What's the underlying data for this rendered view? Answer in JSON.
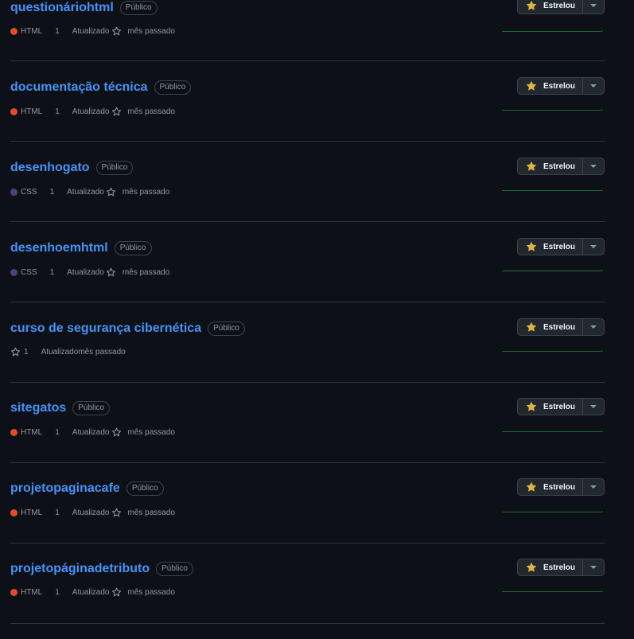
{
  "colors": {
    "html": "#e34c26",
    "css": "#563d7c",
    "star": "#e3b341",
    "spark": "#196c2e"
  },
  "repos": [
    {
      "name": "questionáriohtml",
      "visibility": "Público",
      "language": "HTML",
      "count": "1",
      "updated_label": "Atualizado",
      "updated_time": "mês passado",
      "star_label": "Estrelou"
    },
    {
      "name": "documentação técnica",
      "visibility": "Público",
      "language": "HTML",
      "count": "1",
      "updated_label": "Atualizado",
      "updated_time": "mês passado",
      "star_label": "Estrelou"
    },
    {
      "name": "desenhogato",
      "visibility": "Público",
      "language": "CSS",
      "count": "1",
      "updated_label": "Atualizado",
      "updated_time": "mês passado",
      "star_label": "Estrelou"
    },
    {
      "name": "desenhoemhtml",
      "visibility": "Público",
      "language": "CSS",
      "count": "1",
      "updated_label": "Atualizado",
      "updated_time": "mês passado",
      "star_label": "Estrelou"
    },
    {
      "name": "curso de segurança cibernética",
      "visibility": "Público",
      "language": "",
      "count": "1",
      "updated_label": "Atualizado",
      "updated_time": "mês passado",
      "star_label": "Estrelou"
    },
    {
      "name": "sitegatos",
      "visibility": "Público",
      "language": "HTML",
      "count": "1",
      "updated_label": "Atualizado",
      "updated_time": "mês passado",
      "star_label": "Estrelou"
    },
    {
      "name": "projetopaginacafe",
      "visibility": "Público",
      "language": "HTML",
      "count": "1",
      "updated_label": "Atualizado",
      "updated_time": "mês passado",
      "star_label": "Estrelou"
    },
    {
      "name": "projetopáginadetributo",
      "visibility": "Público",
      "language": "HTML",
      "count": "1",
      "updated_label": "Atualizado",
      "updated_time": "mês passado",
      "star_label": "Estrelou"
    }
  ]
}
